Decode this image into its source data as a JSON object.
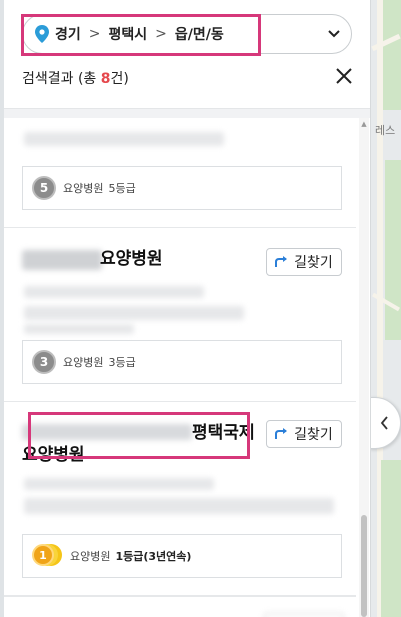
{
  "location": {
    "crumbs": [
      "경기",
      "평택시",
      "읍/면/동"
    ],
    "separator": ">"
  },
  "results": {
    "label_prefix": "검색결과 (총 ",
    "count": "8",
    "label_suffix": "건)"
  },
  "cards": [
    {
      "grade_number": "5",
      "grade_type": "요양병원",
      "grade_value": "5등급"
    },
    {
      "title": "요양병원",
      "directions_label": "길찾기",
      "grade_number": "3",
      "grade_type": "요양병원",
      "grade_value": "3등급"
    },
    {
      "title_line1": "평택국제",
      "title_line2": "요양병원",
      "directions_label": "길찾기",
      "grade_number": "1",
      "grade_type": "요양병원",
      "grade_value": "1등급(3년연속)"
    }
  ],
  "map": {
    "label": "레스"
  },
  "colors": {
    "highlight": "#d6387a",
    "count": "#e5484d",
    "pin": "#2b9cd8",
    "gold": "#f0a418"
  }
}
